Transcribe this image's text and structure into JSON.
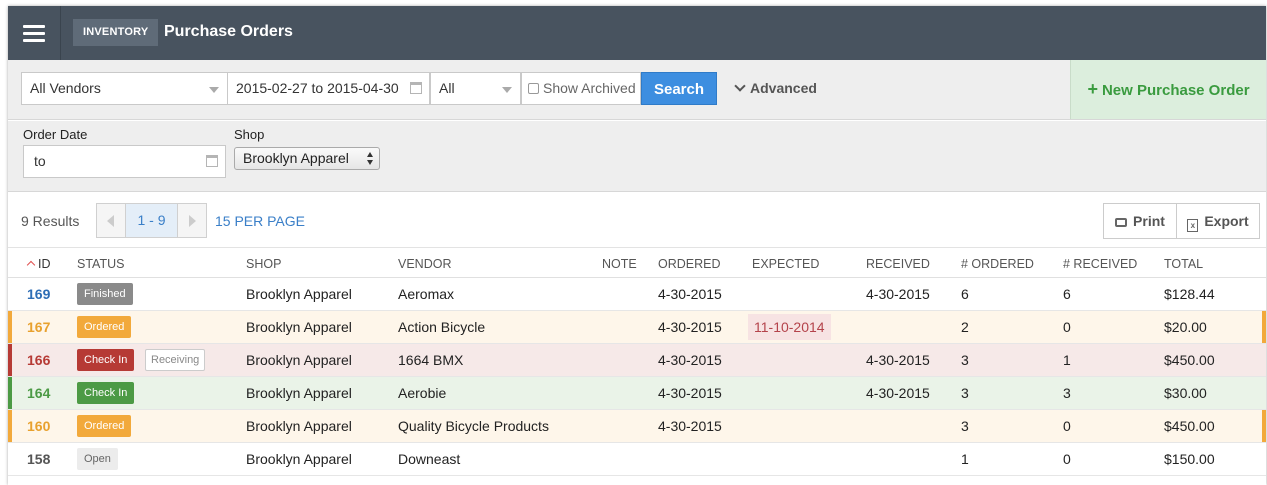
{
  "colors": {
    "topbar": "#48535f",
    "primary": "#3d8ee0",
    "new_po_bg": "#dceedd",
    "new_po_text": "#3a9b3f",
    "finished": "#8a8a8a",
    "ordered": "#f2a93b",
    "check_in_red": "#b63a35",
    "check_in_green": "#4c9a45",
    "open": "#ececec"
  },
  "header": {
    "menu_icon": "hamburger-icon",
    "breadcrumb": "INVENTORY",
    "title": "Purchase Orders"
  },
  "filters": {
    "vendor_select": "All Vendors",
    "date_range": "2015-02-27 to 2015-04-30",
    "status_select": "All",
    "show_archived_label": "Show Archived",
    "search_label": "Search",
    "advanced_label": "Advanced",
    "new_po_label": "New Purchase Order"
  },
  "advanced": {
    "order_date_label": "Order Date",
    "order_date_value": "to",
    "shop_label": "Shop",
    "shop_value": "Brooklyn Apparel"
  },
  "results": {
    "count_text": "9 Results",
    "page_range": "1 - 9",
    "per_page": "15 PER PAGE",
    "print_label": "Print",
    "export_label": "Export"
  },
  "table": {
    "headers": {
      "id": "ID",
      "status": "STATUS",
      "shop": "SHOP",
      "vendor": "VENDOR",
      "note": "NOTE",
      "ordered": "ORDERED",
      "expected": "EXPECTED",
      "received": "RECEIVED",
      "num_ordered": "# ORDERED",
      "num_received": "# RECEIVED",
      "total": "TOTAL"
    },
    "rows": [
      {
        "id": "169",
        "status": "Finished",
        "sub": "",
        "shop": "Brooklyn Apparel",
        "vendor": "Aeromax",
        "ordered": "4-30-2015",
        "expected": "",
        "received": "4-30-2015",
        "num_ordered": "6",
        "num_received": "6",
        "total": "$128.44"
      },
      {
        "id": "167",
        "status": "Ordered",
        "sub": "",
        "shop": "Brooklyn Apparel",
        "vendor": "Action Bicycle",
        "ordered": "4-30-2015",
        "expected": "11-10-2014",
        "received": "",
        "num_ordered": "2",
        "num_received": "0",
        "total": "$20.00"
      },
      {
        "id": "166",
        "status": "Check In",
        "sub": "Receiving",
        "shop": "Brooklyn Apparel",
        "vendor": "1664 BMX",
        "ordered": "4-30-2015",
        "expected": "",
        "received": "4-30-2015",
        "num_ordered": "3",
        "num_received": "1",
        "total": "$450.00"
      },
      {
        "id": "164",
        "status": "Check In",
        "sub": "",
        "shop": "Brooklyn Apparel",
        "vendor": "Aerobie",
        "ordered": "4-30-2015",
        "expected": "",
        "received": "4-30-2015",
        "num_ordered": "3",
        "num_received": "3",
        "total": "$30.00"
      },
      {
        "id": "160",
        "status": "Ordered",
        "sub": "",
        "shop": "Brooklyn Apparel",
        "vendor": "Quality Bicycle Products",
        "ordered": "4-30-2015",
        "expected": "",
        "received": "",
        "num_ordered": "3",
        "num_received": "0",
        "total": "$450.00"
      },
      {
        "id": "158",
        "status": "Open",
        "sub": "",
        "shop": "Brooklyn Apparel",
        "vendor": "Downeast",
        "ordered": "",
        "expected": "",
        "received": "",
        "num_ordered": "1",
        "num_received": "0",
        "total": "$150.00"
      }
    ]
  }
}
